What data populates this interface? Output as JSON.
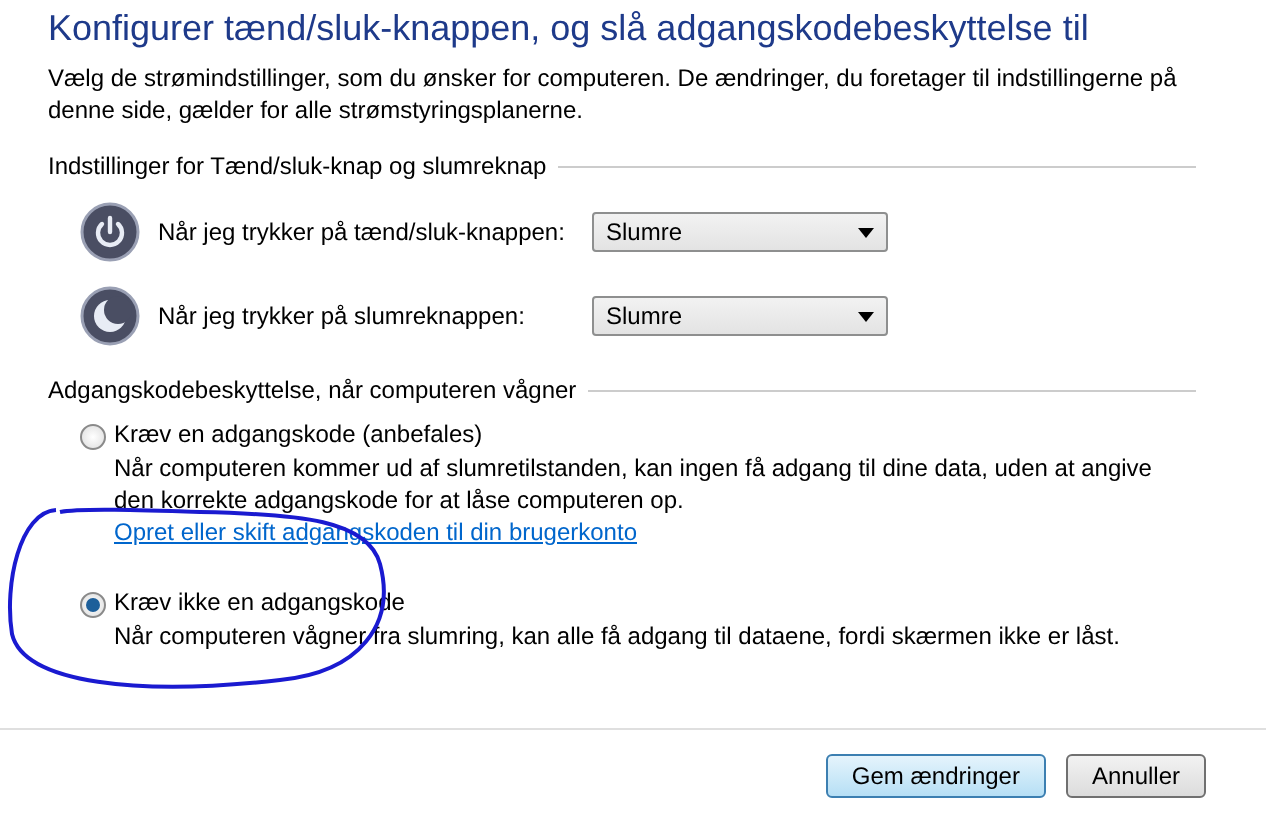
{
  "title": "Konfigurer tænd/sluk-knappen, og slå adgangskodebeskyttelse til",
  "description": "Vælg de strømindstillinger, som du ønsker for computeren. De ændringer, du foretager til indstillingerne på denne side, gælder for alle strømstyringsplanerne.",
  "power_section": {
    "heading": "Indstillinger for Tænd/sluk-knap og slumreknap",
    "rows": [
      {
        "kind": "power",
        "label": "Når jeg trykker på tænd/sluk-knappen:",
        "value": "Slumre"
      },
      {
        "kind": "sleep",
        "label": "Når jeg trykker på slumreknappen:",
        "value": "Slumre"
      }
    ]
  },
  "password_section": {
    "heading": "Adgangskodebeskyttelse, når computeren vågner",
    "options": [
      {
        "label": "Kræv en adgangskode (anbefales)",
        "selected": false,
        "description": "Når computeren kommer ud af slumretilstanden, kan ingen få adgang til dine data, uden at angive den korrekte adgangskode for at låse computeren op.",
        "link": "Opret eller skift adgangskoden til din brugerkonto"
      },
      {
        "label": "Kræv ikke en adgangskode",
        "selected": true,
        "description": "Når computeren vågner fra slumring, kan alle få adgang til dataene, fordi skærmen ikke er låst."
      }
    ]
  },
  "buttons": [
    {
      "label": "Gem ændringer",
      "kind": "primary"
    },
    {
      "label": "Annuller",
      "kind": "normal"
    }
  ]
}
